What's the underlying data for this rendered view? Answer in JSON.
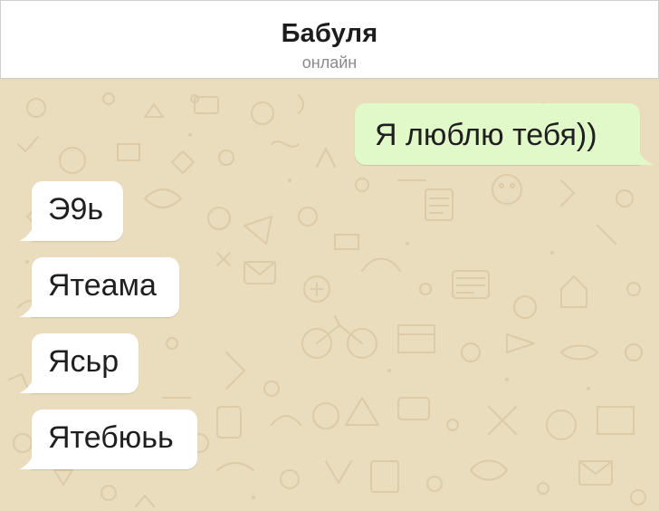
{
  "header": {
    "title": "Бабуля",
    "status": "онлайн"
  },
  "colors": {
    "chat_background": "#e9ddbd",
    "outgoing_bubble": "#e1f8c8",
    "incoming_bubble": "#ffffff",
    "doodle": "#dcccab"
  },
  "messages": {
    "outgoing": [
      {
        "text": "Я люблю тебя))"
      }
    ],
    "incoming": [
      {
        "text": "Э9ь"
      },
      {
        "text": "Ятеама"
      },
      {
        "text": "Ясьр"
      },
      {
        "text": "Ятебюьь"
      }
    ]
  }
}
